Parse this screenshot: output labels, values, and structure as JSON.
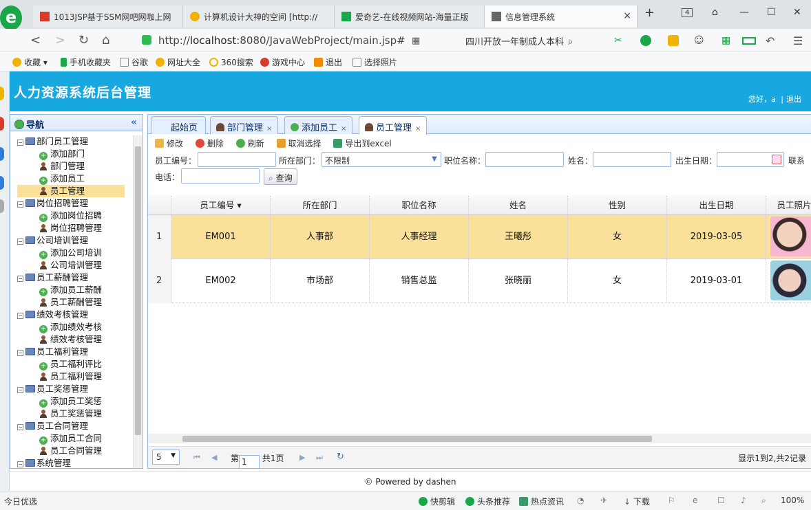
{
  "browser": {
    "tabs": [
      {
        "label": "1013JSP基于SSM网吧网咖上网",
        "color": "#d83b2b"
      },
      {
        "label": "计算机设计大神的空间 [http://",
        "color": "#f0b400"
      },
      {
        "label": "爱奇艺-在线视频网站-海量正版",
        "color": "#1aa74a"
      },
      {
        "label": "信息管理系统",
        "color": "#666666"
      }
    ],
    "active_tab_close": "×",
    "new_tab": "+",
    "tab_count": "4",
    "url_protocol": "http://",
    "url_host": "localhost",
    "url_path": ":8080/JavaWebProject/main.jsp#",
    "search_text": "四川开放一年制成人本科",
    "bookmarks": [
      "收藏",
      "手机收藏夹",
      "谷歌",
      "网址大全",
      "360搜索",
      "游戏中心",
      "退出",
      "选择照片"
    ],
    "status_left": "今日优选",
    "status_items": [
      "快剪辑",
      "头条推荐",
      "热点资讯",
      "下载"
    ],
    "zoom": "100%"
  },
  "app": {
    "title": "人力资源系统后台管理",
    "greeting": "您好，a",
    "logout": "退出",
    "separator": "|",
    "footer": "© Powered by dashen"
  },
  "sidebar": {
    "title": "导航",
    "collapse_icon": "«",
    "tree": [
      {
        "label": "部门员工管理",
        "level": 1
      },
      {
        "label": "添加部门",
        "level": 2,
        "icon": "add"
      },
      {
        "label": "部门管理",
        "level": 2,
        "icon": "user"
      },
      {
        "label": "添加员工",
        "level": 2,
        "icon": "add"
      },
      {
        "label": "员工管理",
        "level": 2,
        "icon": "user",
        "selected": true
      },
      {
        "label": "岗位招聘管理",
        "level": 1
      },
      {
        "label": "添加岗位招聘",
        "level": 2,
        "icon": "add"
      },
      {
        "label": "岗位招聘管理",
        "level": 2,
        "icon": "user"
      },
      {
        "label": "公司培训管理",
        "level": 1
      },
      {
        "label": "添加公司培训",
        "level": 2,
        "icon": "add"
      },
      {
        "label": "公司培训管理",
        "level": 2,
        "icon": "user"
      },
      {
        "label": "员工薪酬管理",
        "level": 1
      },
      {
        "label": "添加员工薪酬",
        "level": 2,
        "icon": "add"
      },
      {
        "label": "员工薪酬管理",
        "level": 2,
        "icon": "user"
      },
      {
        "label": "绩效考核管理",
        "level": 1
      },
      {
        "label": "添加绩效考核",
        "level": 2,
        "icon": "add"
      },
      {
        "label": "绩效考核管理",
        "level": 2,
        "icon": "user"
      },
      {
        "label": "员工福利管理",
        "level": 1
      },
      {
        "label": "员工福利评比",
        "level": 2,
        "icon": "add"
      },
      {
        "label": "员工福利管理",
        "level": 2,
        "icon": "user"
      },
      {
        "label": "员工奖惩管理",
        "level": 1
      },
      {
        "label": "添加员工奖惩",
        "level": 2,
        "icon": "add"
      },
      {
        "label": "员工奖惩管理",
        "level": 2,
        "icon": "user"
      },
      {
        "label": "员工合同管理",
        "level": 1
      },
      {
        "label": "添加员工合同",
        "level": 2,
        "icon": "add"
      },
      {
        "label": "员工合同管理",
        "level": 2,
        "icon": "user"
      },
      {
        "label": "系统管理",
        "level": 1
      }
    ]
  },
  "main": {
    "tabs": [
      {
        "label": "起始页",
        "closable": false
      },
      {
        "label": "部门管理",
        "closable": true
      },
      {
        "label": "添加员工",
        "closable": true
      },
      {
        "label": "员工管理",
        "closable": true,
        "active": true
      }
    ],
    "toolbar": {
      "edit": "修改",
      "delete": "删除",
      "refresh": "刷新",
      "unselect": "取消选择",
      "export": "导出到excel"
    },
    "filters": {
      "employee_no_label": "员工编号：",
      "employee_no_value": "",
      "department_label": "所在部门：",
      "department_value": "不限制",
      "position_label": "职位名称：",
      "position_value": "",
      "name_label": "姓名：",
      "name_value": "",
      "birth_label": "出生日期：",
      "birth_value": "",
      "contact_label": "联系",
      "phone_label": "电话：",
      "phone_value": "",
      "query_button": "查询"
    },
    "table": {
      "columns": [
        "员工编号",
        "所在部门",
        "职位名称",
        "姓名",
        "性别",
        "出生日期",
        "员工照片"
      ],
      "sort_indicator": "▾",
      "rows": [
        {
          "index": "1",
          "cells": [
            "EM001",
            "人事部",
            "人事经理",
            "王曦彤",
            "女",
            "2019-03-05"
          ],
          "selected": true
        },
        {
          "index": "2",
          "cells": [
            "EM002",
            "市场部",
            "销售总监",
            "张晓丽",
            "女",
            "2019-03-01"
          ],
          "selected": false
        }
      ]
    },
    "pager": {
      "page_size": "5",
      "page_prefix": "第",
      "page_value": "1",
      "page_total": "共1页",
      "summary": "显示1到2,共2记录"
    }
  }
}
